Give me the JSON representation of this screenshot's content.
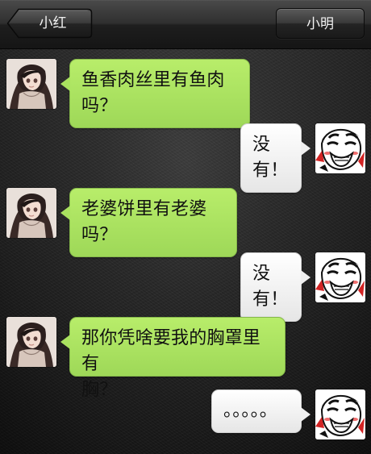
{
  "header": {
    "back_label": "小红",
    "right_label": "小明"
  },
  "messages": [
    {
      "text": "鱼香肉丝里有鱼肉吗？"
    },
    {
      "text": "没有！"
    },
    {
      "text": "老婆饼里有老婆吗？"
    },
    {
      "text": "没有！"
    },
    {
      "text": "那你凭啥要我的胸罩里有\n胸？"
    },
    {
      "text": "。。。。。"
    }
  ],
  "colors": {
    "left_bubble": "#A9E25F",
    "right_bubble": "#F0F0F0",
    "top_bar": "#2A2A2A"
  }
}
